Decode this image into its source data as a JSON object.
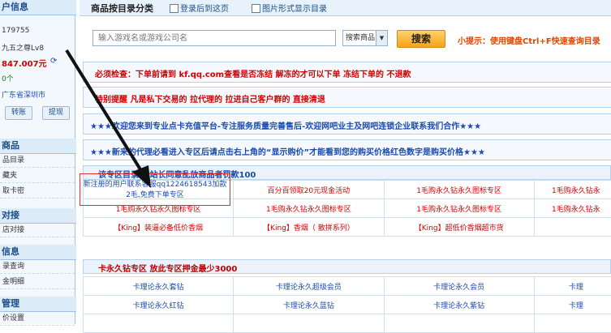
{
  "sidebar": {
    "header": "户信息",
    "user_id": "179755",
    "nickname": "九五之尊Lv8",
    "balance": "847.007元",
    "count": "0个",
    "location": "广东省深圳市",
    "btn_transfer": "转账",
    "btn_withdraw": "提现",
    "section_goods": "商品",
    "goods_items": [
      "品目录",
      "藏夹",
      "取卡密"
    ],
    "section_connect": "对接",
    "connect_items": [
      "店对接"
    ],
    "section_info": "信息",
    "info_items": [
      "录查询",
      "金明细"
    ],
    "section_manage": "管理",
    "manage_items": [
      "价设置"
    ]
  },
  "toolbar": {
    "title": "商品按目录分类",
    "checkbox1": "登录后到这页",
    "checkbox2": "图片形式显示目录"
  },
  "search": {
    "placeholder": "输入游戏名或游戏公司名",
    "category": "搜索商品",
    "button": "搜索",
    "tip": "小提示：使用键盘Ctrl+F快速查询目录"
  },
  "notices": {
    "n1": "必须检查：下单前请到  kf.qq.com查看是否冻结  解冻的才可以下单  冻结下单的  不退款",
    "n2": "特别提醒  凡是私下交易的  拉代理的  拉进自己客户群的  直接清退",
    "n3": "★★★欢迎您来到专业点卡充值平台-专注服务质量完善售后-欢迎网吧业主及网吧连锁企业联系我们合作★★★",
    "n4": "★★★新来的代理必看进入专区后请点击右上角的“显示购价”才能看到您的购买价格红色数字是购买价格★★★"
  },
  "section1": {
    "title": "该专区目录  经站长同意乱放商品者罚款100",
    "highlight_text": "新注册的用户联系客服qq1224618543加款2毛,免费下单专区",
    "rows": [
      [
        "",
        "百分百领取20元现金活动",
        "1毛购永久钻永久图标专区",
        "1毛购永久钻永"
      ],
      [
        "1毛购永久钻永久图标专区",
        "1毛购永久钻永久图标专区",
        "1毛购永久钻永久图标专区",
        "1毛购永久钻永"
      ],
      [
        "【King】装逼必备低价香烟",
        "【King】香烟（ 散拼系列）",
        "【King】超低价香烟超市货",
        ""
      ]
    ]
  },
  "section2": {
    "title": "卡永久钻专区  放此专区押金最少3000",
    "rows": [
      [
        "卡理论永久套钻",
        "卡理论永久超级会员",
        "卡理论永久会员",
        "卡理"
      ],
      [
        "卡理论永久红钻",
        "卡理论永久蓝钻",
        "卡理论永久紫钻",
        "卡理"
      ],
      [
        "",
        "",
        "",
        ""
      ]
    ]
  },
  "colors": {
    "accent_red": "#d40000",
    "link_blue": "#1b4bb0",
    "border_blue": "#b6d2ec"
  }
}
